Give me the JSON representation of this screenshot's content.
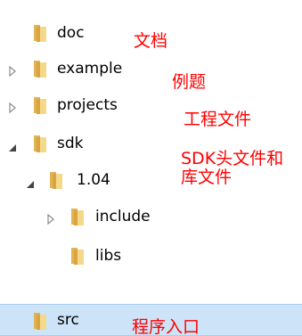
{
  "tree": {
    "items": [
      {
        "label": "doc",
        "expander": "none"
      },
      {
        "label": "example",
        "expander": "collapsed"
      },
      {
        "label": "projects",
        "expander": "collapsed"
      },
      {
        "label": "sdk",
        "expander": "expanded"
      },
      {
        "label": "1.04",
        "expander": "expanded"
      },
      {
        "label": "include",
        "expander": "collapsed"
      },
      {
        "label": "libs",
        "expander": "none"
      },
      {
        "label": "src",
        "expander": "none",
        "selected": true
      }
    ]
  },
  "annotations": {
    "doc": "文档",
    "example": "例题",
    "projects": "工程文件",
    "sdk_line1": "SDK头文件和",
    "sdk_line2": "库文件",
    "src": "程序入口"
  },
  "colors": {
    "annotation": "#ff0000",
    "selection": "#cde3f7",
    "folder": "#e8c26a"
  }
}
